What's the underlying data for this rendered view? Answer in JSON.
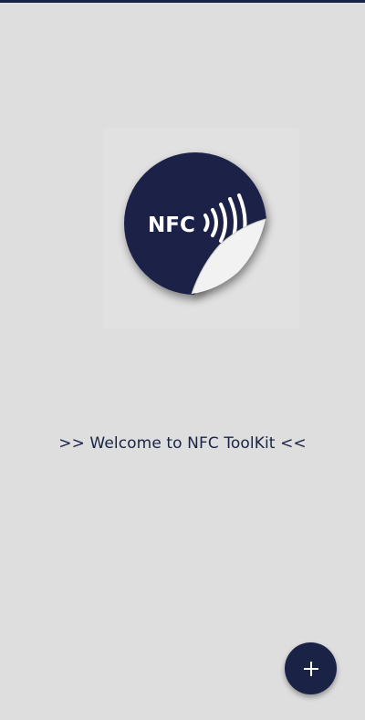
{
  "app": {
    "accent_color": "#1a2346",
    "background_color": "#dedede"
  },
  "logo": {
    "text": "NFC",
    "icon": "nfc-sticker-icon"
  },
  "welcome": {
    "text": ">> Welcome to NFC ToolKit <<"
  },
  "fab": {
    "icon": "plus-icon"
  }
}
